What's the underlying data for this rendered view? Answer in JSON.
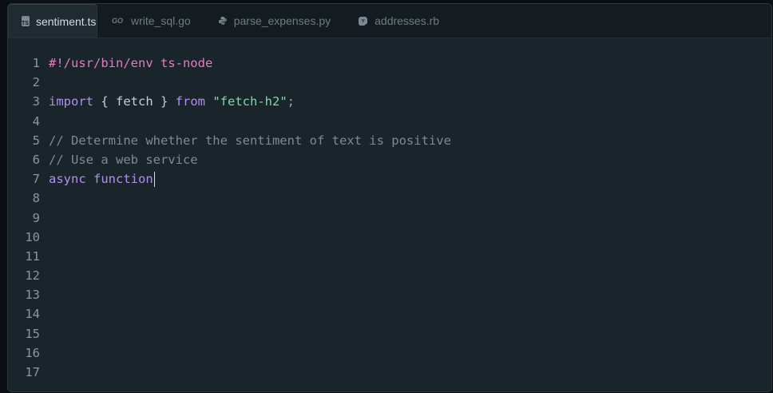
{
  "tabs": [
    {
      "label": "sentiment.ts",
      "icon": "typescript-icon",
      "active": true
    },
    {
      "label": "write_sql.go",
      "icon": "go-icon",
      "active": false
    },
    {
      "label": "parse_expenses.py",
      "icon": "python-icon",
      "active": false
    },
    {
      "label": "addresses.rb",
      "icon": "ruby-icon",
      "active": false
    }
  ],
  "ts_badge": "TS",
  "go_badge": "GO",
  "editor": {
    "line_numbers": [
      "1",
      "2",
      "3",
      "4",
      "5",
      "6",
      "7",
      "8",
      "9",
      "10",
      "11",
      "12",
      "13",
      "14",
      "15",
      "16",
      "17"
    ],
    "line1": "#!/usr/bin/env ts-node",
    "line3": {
      "kw1": "import",
      "mid": " { fetch } ",
      "kw2": "from",
      "space": " ",
      "str": "\"fetch-h2\"",
      "semi": ";"
    },
    "line5": "// Determine whether the sentiment of text is positive",
    "line6": "// Use a web service",
    "line7": {
      "kw1": "async",
      "space": " ",
      "kw2": "function"
    }
  },
  "colors": {
    "background": "#1a242b",
    "shebang": "#e07cc4",
    "keyword": "#b08ff0",
    "string": "#7fd8a8",
    "comment": "#7f898f"
  }
}
